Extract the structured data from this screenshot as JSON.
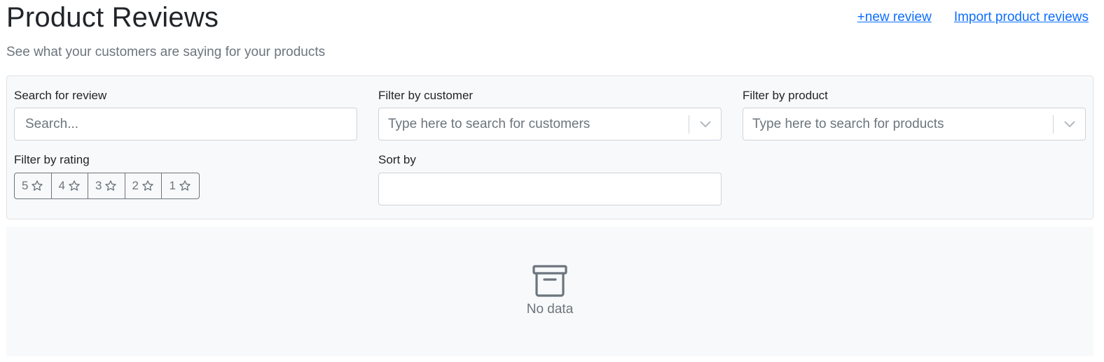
{
  "header": {
    "title": "Product Reviews",
    "subtitle": "See what your customers are saying for your products",
    "new_review_link": "+new review",
    "import_link": "Import product reviews"
  },
  "filters": {
    "search": {
      "label": "Search for review",
      "placeholder": "Search...",
      "value": ""
    },
    "customer": {
      "label": "Filter by customer",
      "placeholder": "Type here to search for customers"
    },
    "product": {
      "label": "Filter by product",
      "placeholder": "Type here to search for products"
    },
    "rating": {
      "label": "Filter by rating",
      "options": [
        "5",
        "4",
        "3",
        "2",
        "1"
      ]
    },
    "sort": {
      "label": "Sort by",
      "value": ""
    }
  },
  "results": {
    "empty_text": "No data",
    "empty_icon": "archive-box-icon"
  },
  "colors": {
    "link": "#0d6efd",
    "muted": "#6c757d",
    "panel_bg": "#f8f9fa"
  }
}
